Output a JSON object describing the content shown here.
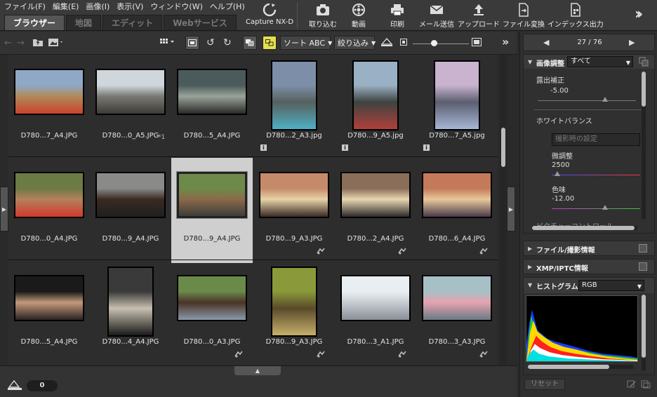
{
  "menu": [
    "ファイル(F)",
    "編集(E)",
    "画像(I)",
    "表示(V)",
    "ウィンドウ(W)",
    "ヘルプ(H)"
  ],
  "tabs": [
    "ブラウザー",
    "地図",
    "エディット",
    "Webサービス"
  ],
  "active_tab": "ブラウザー",
  "top_toolbar": {
    "capture": "Capture NX-D",
    "import": "取り込む",
    "movie": "動画",
    "print": "印刷",
    "mail": "メール送信",
    "upload": "アップロード",
    "convert": "ファイル変換",
    "index": "インデックス出力"
  },
  "browser_toolbar": {
    "sort_label": "ソート ABC",
    "filter_label": "絞り込み"
  },
  "thumbnails": [
    {
      "name": "D780...7_A4.JPG",
      "colors": [
        "#8fa8c6",
        "#b08a5a",
        "#c9432b"
      ],
      "orient": "land"
    },
    {
      "name": "D780...0_A5.JPG",
      "badge": "*1",
      "colors": [
        "#cfd6dc",
        "#7a7a74",
        "#3d3b37"
      ],
      "orient": "land"
    },
    {
      "name": "D780...5_A4.JPG",
      "colors": [
        "#4b5a5a",
        "#9aa39a",
        "#2a2a28"
      ],
      "orient": "land"
    },
    {
      "name": "D780...2_A3.jpg",
      "info": true,
      "colors": [
        "#7d8fa8",
        "#56605e",
        "#4fb0c4"
      ],
      "orient": "port"
    },
    {
      "name": "D780...9_A5.jpg",
      "info": true,
      "colors": [
        "#9ab0c4",
        "#3e4340",
        "#b0403a"
      ],
      "orient": "port"
    },
    {
      "name": "D780...7_A5.jpg",
      "info": true,
      "colors": [
        "#c9b3cf",
        "#5b5e70",
        "#a7b7d6"
      ],
      "orient": "port"
    },
    {
      "name": "D780...0_A4.JPG",
      "colors": [
        "#6c7a44",
        "#b4805c",
        "#d13a2c"
      ],
      "orient": "land"
    },
    {
      "name": "D780...9_A4.JPG",
      "colors": [
        "#8a8a88",
        "#3a2a22",
        "#1f1f1f"
      ],
      "orient": "land"
    },
    {
      "name": "D780...9_A4.JPG",
      "selected": true,
      "colors": [
        "#6e8a4a",
        "#8a6a4a",
        "#3d3d3a"
      ],
      "orient": "land"
    },
    {
      "name": "D780...9_A3.JPG",
      "edit": true,
      "colors": [
        "#c48a6a",
        "#e6d2a6",
        "#3a2a26"
      ],
      "orient": "land"
    },
    {
      "name": "D780...2_A4.JPG",
      "edit": true,
      "colors": [
        "#8a6e5a",
        "#e8d6b0",
        "#2e2a2c"
      ],
      "orient": "land"
    },
    {
      "name": "D780...6_A4.JPG",
      "edit": true,
      "colors": [
        "#c47a5a",
        "#e8c89a",
        "#4a3a4a"
      ],
      "orient": "land"
    },
    {
      "name": "D780...5_A4.JPG",
      "colors": [
        "#1a1a1a",
        "#c49a7a",
        "#2a2222"
      ],
      "orient": "land"
    },
    {
      "name": "D780...4_A4.JPG",
      "colors": [
        "#3a3a3a",
        "#c8c0b0",
        "#1a1a1a"
      ],
      "orient": "port"
    },
    {
      "name": "D780...0_A3.JPG",
      "edit": true,
      "colors": [
        "#6a8a4a",
        "#4a3226",
        "#8a9aa8"
      ],
      "orient": "land"
    },
    {
      "name": "D780...9_A3.JPG",
      "edit": true,
      "colors": [
        "#8a9a3a",
        "#5a4a2a",
        "#c6b06a"
      ],
      "orient": "port"
    },
    {
      "name": "D780...3_A1.JPG",
      "edit": true,
      "colors": [
        "#e8eef2",
        "#c8ccd2",
        "#8a8e96"
      ],
      "orient": "land"
    },
    {
      "name": "D780...3_A3.JPG",
      "edit": true,
      "colors": [
        "#a6c0c6",
        "#e6a2b0",
        "#6a7a82"
      ],
      "orient": "land"
    }
  ],
  "right_panel": {
    "nav_page": "27 / 76",
    "image_adjust_title": "画像調整",
    "image_adjust_dropdown": "すべて",
    "exposure_label": "露出補正",
    "exposure_value": "-5.00",
    "wb_label": "ホワイトバランス",
    "wb_dropdown": "撮影時の設定",
    "fine_adjust_label": "微調整",
    "fine_adjust_value": "2500",
    "tint_label": "色味",
    "tint_value": "-12.00",
    "picture_control_label": "ピクチャーコントロール",
    "file_info_title": "ファイル/撮影情報",
    "xmp_title": "XMP/IPTC情報",
    "histogram_title": "ヒストグラム",
    "histogram_dropdown": "RGB",
    "reset_label": "リセット"
  },
  "bottom": {
    "count": "0"
  }
}
